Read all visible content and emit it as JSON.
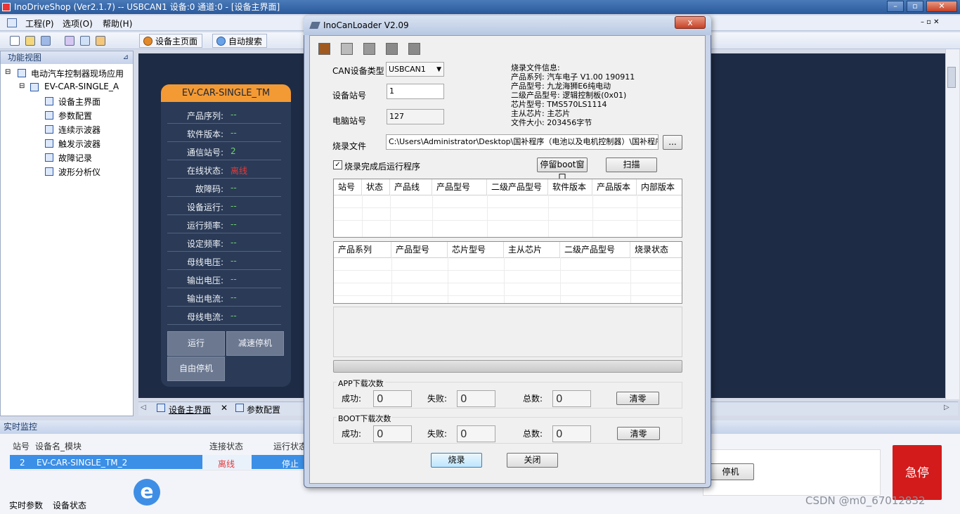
{
  "main": {
    "title": "InoDriveShop (Ver2.1.7) -- USBCAN1 设备:0 通道:0 - [设备主界面]",
    "menu": [
      "工程(P)",
      "选项(O)",
      "帮助(H)"
    ],
    "toolbar_tabs": [
      "设备主页面",
      "自动搜索"
    ],
    "tree_header": "功能视图",
    "tree": {
      "root": "电动汽车控制器现场应用",
      "device": "EV-CAR-SINGLE_A",
      "items": [
        "设备主界面",
        "参数配置",
        "连续示波器",
        "触发示波器",
        "故障记录",
        "波形分析仪"
      ]
    },
    "card": {
      "title": "EV-CAR-SINGLE_TM",
      "rows": [
        {
          "label": "产品序列:",
          "value": "--"
        },
        {
          "label": "软件版本:",
          "value": "--"
        },
        {
          "label": "通信站号:",
          "value": "2"
        },
        {
          "label": "在线状态:",
          "value": "离线"
        },
        {
          "label": "故障码:",
          "value": "--"
        },
        {
          "label": "设备运行:",
          "value": "--"
        },
        {
          "label": "运行频率:",
          "value": "--"
        },
        {
          "label": "设定频率:",
          "value": "--"
        },
        {
          "label": "母线电压:",
          "value": "--"
        },
        {
          "label": "输出电压:",
          "value": "--"
        },
        {
          "label": "输出电流:",
          "value": "--"
        },
        {
          "label": "母线电流:",
          "value": "--"
        }
      ],
      "buttons": [
        "运行",
        "减速停机",
        "自由停机"
      ]
    },
    "doc_tabs": [
      "设备主界面",
      "参数配置"
    ],
    "monitor": {
      "header": "实时监控",
      "columns": [
        "站号",
        "设备名_模块",
        "连接状态",
        "运行状态"
      ],
      "row": {
        "station": "2",
        "name": "EV-CAR-SINGLE_TM_2",
        "conn": "离线",
        "run": "停止"
      },
      "stop_button_partial": "停机",
      "estop": "急停"
    },
    "bottom_tabs": [
      "实时参数",
      "设备状态"
    ],
    "watermark": "CSDN @m0_67012832"
  },
  "dialog": {
    "title": "InoCanLoader V2.09",
    "close": "x",
    "can_type_label": "CAN设备类型",
    "can_type_value": "USBCAN1",
    "station_label": "设备站号",
    "station_value": "1",
    "pc_station_label": "电脑站号",
    "pc_station_value": "127",
    "file_label": "烧录文件",
    "file_value": "C:\\Users\\Administrator\\Desktop\\国补程序（电池以及电机控制器）\\国补程序",
    "browse": "...",
    "run_after_label": "烧录完成后运行程序",
    "keep_boot": "停留boot窗口",
    "scan": "扫描",
    "info": [
      "烧录文件信息:",
      "产品系列: 汽车电子   V1.00 190911",
      "产品型号: 九龙海狮E6纯电动",
      "二级产品型号: 逻辑控制板(0x01)",
      "芯片型号: TMS570LS1114",
      "主从芯片: 主芯片",
      "文件大小: 203456字节"
    ],
    "table1_cols": [
      "站号",
      "状态",
      "产品线",
      "产品型号",
      "二级产品型号",
      "软件版本",
      "产品版本",
      "内部版本"
    ],
    "table2_cols": [
      "产品系列",
      "产品型号",
      "芯片型号",
      "主从芯片",
      "二级产品型号",
      "烧录状态"
    ],
    "app_group": "APP下载次数",
    "boot_group": "BOOT下载次数",
    "success_label": "成功:",
    "fail_label": "失败:",
    "total_label": "总数:",
    "app_counts": {
      "success": "0",
      "fail": "0",
      "total": "0"
    },
    "boot_counts": {
      "success": "0",
      "fail": "0",
      "total": "0"
    },
    "clear": "清零",
    "burn": "烧录",
    "close_btn": "关闭"
  }
}
